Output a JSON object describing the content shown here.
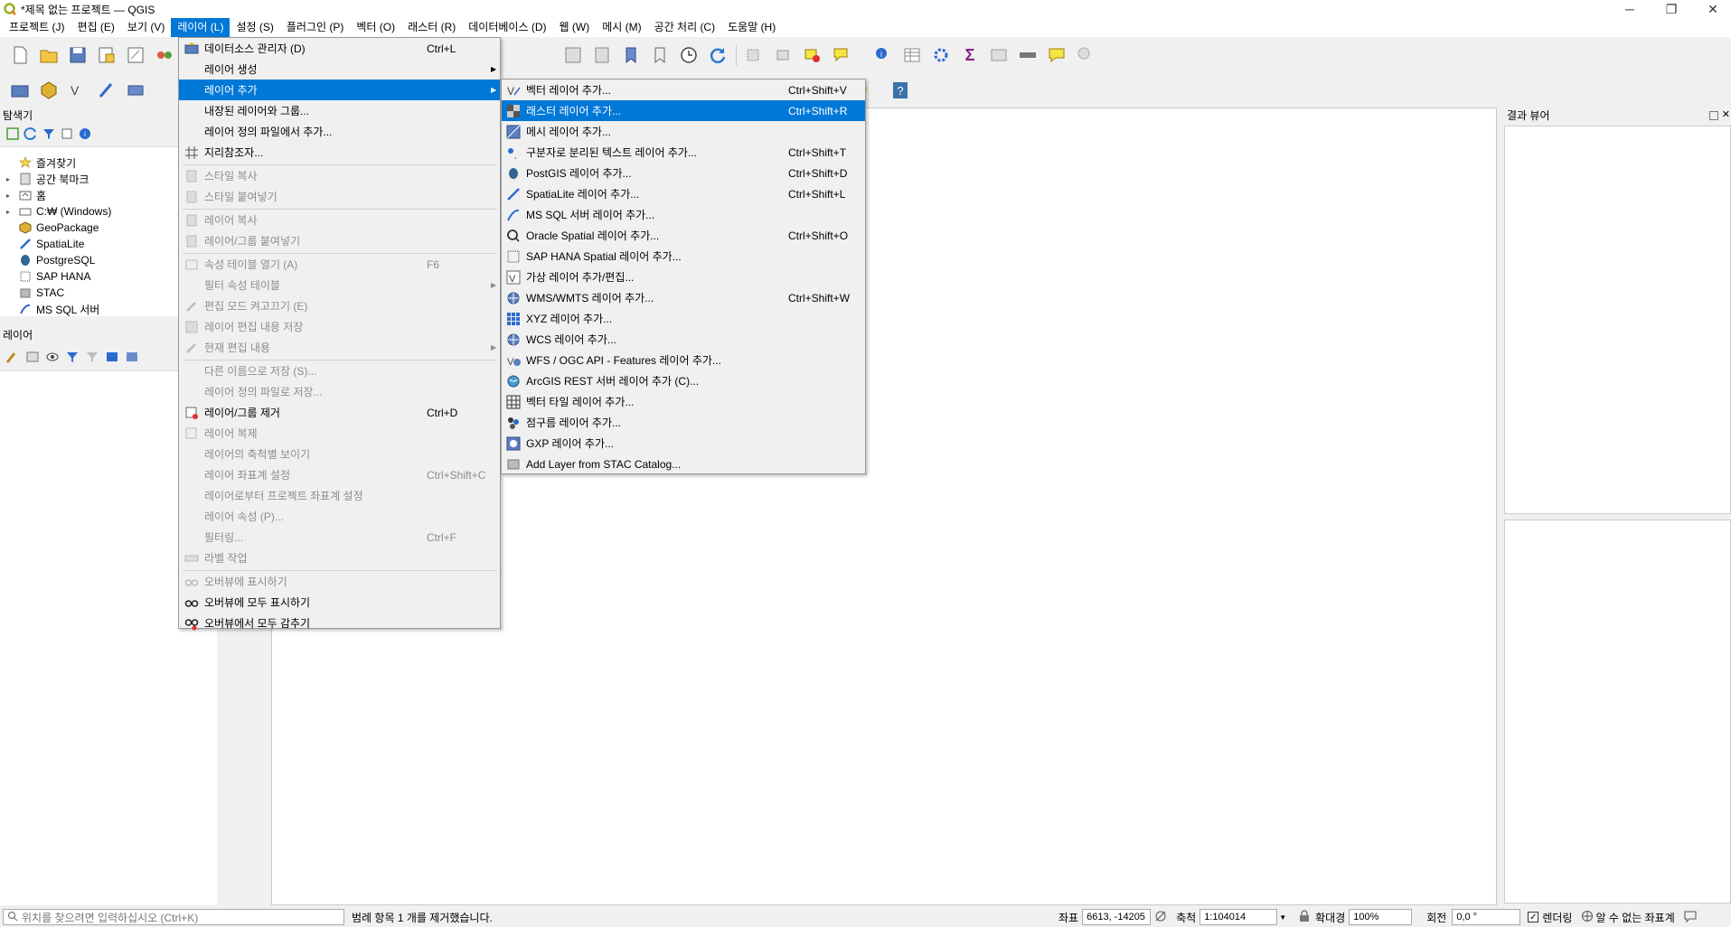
{
  "window": {
    "title": "*제목 없는 프로젝트 — QGIS",
    "minimize": "─",
    "maximize": "❐",
    "close": "✕"
  },
  "menubar": [
    {
      "label": "프로젝트 (J)"
    },
    {
      "label": "편집 (E)"
    },
    {
      "label": "보기 (V)"
    },
    {
      "label": "레이어 (L)"
    },
    {
      "label": "설정 (S)"
    },
    {
      "label": "플러그인 (P)"
    },
    {
      "label": "벡터 (O)"
    },
    {
      "label": "래스터 (R)"
    },
    {
      "label": "데이터베이스 (D)"
    },
    {
      "label": "웹 (W)"
    },
    {
      "label": "메시 (M)"
    },
    {
      "label": "공간 처리 (C)"
    },
    {
      "label": "도움말 (H)"
    }
  ],
  "browser_panel": {
    "title": "탐색기",
    "items": [
      {
        "label": "즐겨찾기",
        "icon": "star-icon"
      },
      {
        "label": "공간 북마크",
        "icon": "bookmark-icon"
      },
      {
        "label": "홈",
        "icon": "home-folder-icon"
      },
      {
        "label": "C:₩ (Windows)",
        "icon": "drive-icon"
      },
      {
        "label": "GeoPackage",
        "icon": "geopackage-icon"
      },
      {
        "label": "SpatiaLite",
        "icon": "spatialite-icon"
      },
      {
        "label": "PostgreSQL",
        "icon": "postgresql-icon"
      },
      {
        "label": "SAP HANA",
        "icon": "sap-hana-icon"
      },
      {
        "label": "STAC",
        "icon": "stac-icon"
      },
      {
        "label": "MS SQL 서버",
        "icon": "mssql-icon"
      }
    ]
  },
  "layers_panel": {
    "title": "레이어"
  },
  "results_panel": {
    "title": "결과 뷰어"
  },
  "layer_menu": {
    "items": [
      {
        "label": "데이터소스 관리자 (D)",
        "shortcut": "Ctrl+L"
      },
      {
        "label": "레이어 생성",
        "shortcut": ""
      },
      {
        "label": "레이어 추가",
        "shortcut": ""
      },
      {
        "label": "내장된 레이어와 그룹...",
        "shortcut": ""
      },
      {
        "label": "레이어 정의 파일에서 추가...",
        "shortcut": ""
      },
      {
        "label": "지리참조자...",
        "shortcut": ""
      },
      {
        "label": "스타일 복사",
        "shortcut": ""
      },
      {
        "label": "스타일 붙여넣기",
        "shortcut": ""
      },
      {
        "label": "레이어 복사",
        "shortcut": ""
      },
      {
        "label": "레이어/그룹 붙여넣기",
        "shortcut": ""
      },
      {
        "label": "속성 테이블 열기 (A)",
        "shortcut": "F6"
      },
      {
        "label": "필터 속성 테이블",
        "shortcut": ""
      },
      {
        "label": "편집 모드 켜고끄기 (E)",
        "shortcut": ""
      },
      {
        "label": "레이어 편집 내용 저장",
        "shortcut": ""
      },
      {
        "label": "현재 편집 내용",
        "shortcut": ""
      },
      {
        "label": "다른 이름으로 저장 (S)...",
        "shortcut": ""
      },
      {
        "label": "레이어 정의 파일로 저장...",
        "shortcut": ""
      },
      {
        "label": "레이어/그룹 제거",
        "shortcut": "Ctrl+D"
      },
      {
        "label": "레이어 복제",
        "shortcut": ""
      },
      {
        "label": "레이어의 축척별 보이기",
        "shortcut": ""
      },
      {
        "label": "레이어 좌표계 설정",
        "shortcut": "Ctrl+Shift+C"
      },
      {
        "label": "레이어로부터 프로젝트 좌표계 설정",
        "shortcut": ""
      },
      {
        "label": "레이어 속성 (P)...",
        "shortcut": ""
      },
      {
        "label": "필터링...",
        "shortcut": "Ctrl+F"
      },
      {
        "label": "라벨 작업",
        "shortcut": ""
      },
      {
        "label": "오버뷰에 표시하기",
        "shortcut": ""
      },
      {
        "label": "오버뷰에 모두 표시하기",
        "shortcut": ""
      },
      {
        "label": "오버뷰에서 모두 감추기",
        "shortcut": ""
      }
    ]
  },
  "add_layer_submenu": {
    "items": [
      {
        "label": "벡터 레이어 추가...",
        "shortcut": "Ctrl+Shift+V"
      },
      {
        "label": "래스터 레이어 추가...",
        "shortcut": "Ctrl+Shift+R"
      },
      {
        "label": "메시 레이어 추가...",
        "shortcut": ""
      },
      {
        "label": "구분자로 분리된 텍스트 레이어 추가...",
        "shortcut": "Ctrl+Shift+T"
      },
      {
        "label": "PostGIS 레이어 추가...",
        "shortcut": "Ctrl+Shift+D"
      },
      {
        "label": "SpatiaLite 레이어 추가...",
        "shortcut": "Ctrl+Shift+L"
      },
      {
        "label": "MS SQL 서버 레이어 추가...",
        "shortcut": ""
      },
      {
        "label": "Oracle Spatial 레이어 추가...",
        "shortcut": "Ctrl+Shift+O"
      },
      {
        "label": "SAP HANA Spatial 레이어 추가...",
        "shortcut": ""
      },
      {
        "label": "가상 레이어 추가/편집...",
        "shortcut": ""
      },
      {
        "label": "WMS/WMTS 레이어 추가...",
        "shortcut": "Ctrl+Shift+W"
      },
      {
        "label": "XYZ 레이어 추가...",
        "shortcut": ""
      },
      {
        "label": "WCS 레이어 추가...",
        "shortcut": ""
      },
      {
        "label": "WFS / OGC API - Features 레이어 추가...",
        "shortcut": ""
      },
      {
        "label": "ArcGIS REST 서버 레이어 추가 (C)...",
        "shortcut": ""
      },
      {
        "label": "벡터 타일 레이어 추가...",
        "shortcut": ""
      },
      {
        "label": "점구름 레이어 추가...",
        "shortcut": ""
      },
      {
        "label": "GXP 레이어 추가...",
        "shortcut": ""
      },
      {
        "label": "Add Layer from STAC Catalog...",
        "shortcut": ""
      }
    ]
  },
  "statusbar": {
    "search_placeholder": "위치를 찾으려면 입력하십시오 (Ctrl+K)",
    "message": "범례 항목 1 개를 제거했습니다.",
    "coord_label": "좌표",
    "coord_value": "6613, -14205",
    "scale_label": "축척",
    "scale_value": "1:104014",
    "magnifier_label": "확대경",
    "magnifier_value": "100%",
    "rotation_label": "회전",
    "rotation_value": "0,0 °",
    "render_label": "렌더링",
    "crs_label": "알 수 없는 좌표계"
  },
  "colors": {
    "highlight": "#0078d7",
    "menu_bg": "#f0f0f0"
  }
}
